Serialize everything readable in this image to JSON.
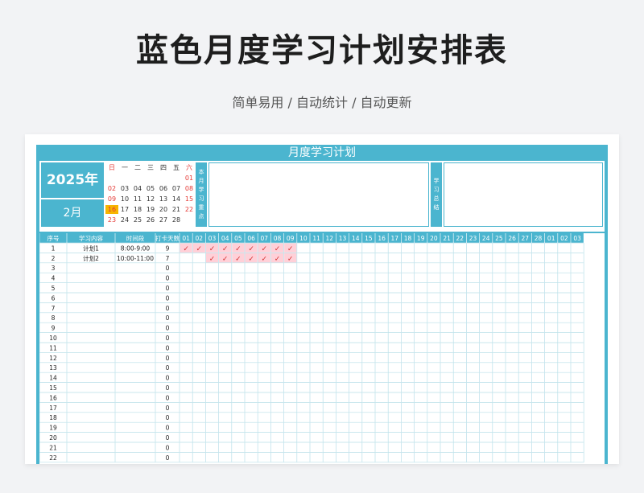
{
  "page": {
    "title": "蓝色月度学习计划安排表",
    "subtitle": "简单易用 / 自动统计 / 自动更新"
  },
  "sheet": {
    "title": "月度学习计划",
    "year": "2025年",
    "month": "2月",
    "focus_label": [
      "本",
      "月",
      "学",
      "习",
      "重",
      "点"
    ],
    "summary_label": [
      "学",
      "习",
      "总",
      "结"
    ],
    "weekdays": [
      "日",
      "一",
      "二",
      "三",
      "四",
      "五",
      "六"
    ],
    "calendar_weeks": [
      [
        "",
        "",
        "",
        "",
        "",
        "",
        "01"
      ],
      [
        "02",
        "03",
        "04",
        "05",
        "06",
        "07",
        "08"
      ],
      [
        "09",
        "10",
        "11",
        "12",
        "13",
        "14",
        "15"
      ],
      [
        "16",
        "17",
        "18",
        "19",
        "20",
        "21",
        "22"
      ],
      [
        "23",
        "24",
        "25",
        "26",
        "27",
        "28",
        ""
      ]
    ],
    "today": "16"
  },
  "table": {
    "headers": [
      "序号",
      "学习内容",
      "时间段",
      "打卡天数"
    ],
    "days": [
      "01",
      "02",
      "03",
      "04",
      "05",
      "06",
      "07",
      "08",
      "09",
      "10",
      "11",
      "12",
      "13",
      "14",
      "15",
      "16",
      "17",
      "18",
      "19",
      "20",
      "21",
      "22",
      "23",
      "24",
      "25",
      "26",
      "27",
      "28",
      "01",
      "02",
      "03"
    ],
    "checkmark": "✓",
    "rows": [
      {
        "no": "1",
        "content": "计划1",
        "time": "8:00-9:00",
        "count": "9",
        "checked": [
          0,
          1,
          2,
          3,
          4,
          5,
          6,
          7,
          8
        ]
      },
      {
        "no": "2",
        "content": "计划2",
        "time": "10:00-11:00",
        "count": "7",
        "checked": [
          2,
          3,
          4,
          5,
          6,
          7,
          8
        ]
      },
      {
        "no": "3",
        "content": "",
        "time": "",
        "count": "0",
        "checked": []
      },
      {
        "no": "4",
        "content": "",
        "time": "",
        "count": "0",
        "checked": []
      },
      {
        "no": "5",
        "content": "",
        "time": "",
        "count": "0",
        "checked": []
      },
      {
        "no": "6",
        "content": "",
        "time": "",
        "count": "0",
        "checked": []
      },
      {
        "no": "7",
        "content": "",
        "time": "",
        "count": "0",
        "checked": []
      },
      {
        "no": "8",
        "content": "",
        "time": "",
        "count": "0",
        "checked": []
      },
      {
        "no": "9",
        "content": "",
        "time": "",
        "count": "0",
        "checked": []
      },
      {
        "no": "10",
        "content": "",
        "time": "",
        "count": "0",
        "checked": []
      },
      {
        "no": "11",
        "content": "",
        "time": "",
        "count": "0",
        "checked": []
      },
      {
        "no": "12",
        "content": "",
        "time": "",
        "count": "0",
        "checked": []
      },
      {
        "no": "13",
        "content": "",
        "time": "",
        "count": "0",
        "checked": []
      },
      {
        "no": "14",
        "content": "",
        "time": "",
        "count": "0",
        "checked": []
      },
      {
        "no": "15",
        "content": "",
        "time": "",
        "count": "0",
        "checked": []
      },
      {
        "no": "16",
        "content": "",
        "time": "",
        "count": "0",
        "checked": []
      },
      {
        "no": "17",
        "content": "",
        "time": "",
        "count": "0",
        "checked": []
      },
      {
        "no": "18",
        "content": "",
        "time": "",
        "count": "0",
        "checked": []
      },
      {
        "no": "19",
        "content": "",
        "time": "",
        "count": "0",
        "checked": []
      },
      {
        "no": "20",
        "content": "",
        "time": "",
        "count": "0",
        "checked": []
      },
      {
        "no": "21",
        "content": "",
        "time": "",
        "count": "0",
        "checked": []
      },
      {
        "no": "22",
        "content": "",
        "time": "",
        "count": "0",
        "checked": []
      }
    ]
  },
  "colors": {
    "accent": "#4bb5cf",
    "checked_fill": "#ffd0d8",
    "check_mark": "#d32f2f",
    "weekend_red": "#e53935",
    "today_fill": "#f7b500",
    "grid_line": "#b9dfe9"
  }
}
